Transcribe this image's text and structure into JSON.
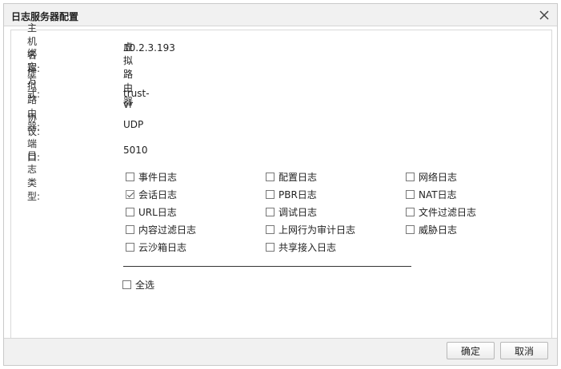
{
  "dialog": {
    "title": "日志服务器配置"
  },
  "fields": [
    {
      "label": "主机名称:",
      "value": "10.2.3.193"
    },
    {
      "label": "绑定方式:",
      "value": "虚拟路由器"
    },
    {
      "label": "虚拟路由器:",
      "value": "trust-vr"
    },
    {
      "label": "协议:",
      "value": "UDP"
    },
    {
      "label": "端口:",
      "value": "5010"
    }
  ],
  "log_types": {
    "label": "日志类型:",
    "items": [
      {
        "label": "事件日志",
        "checked": false
      },
      {
        "label": "配置日志",
        "checked": false
      },
      {
        "label": "网络日志",
        "checked": false
      },
      {
        "label": "会话日志",
        "checked": true
      },
      {
        "label": "PBR日志",
        "checked": false
      },
      {
        "label": "NAT日志",
        "checked": false
      },
      {
        "label": "URL日志",
        "checked": false
      },
      {
        "label": "调试日志",
        "checked": false
      },
      {
        "label": "文件过滤日志",
        "checked": false
      },
      {
        "label": "内容过滤日志",
        "checked": false
      },
      {
        "label": "上网行为审计日志",
        "checked": false
      },
      {
        "label": "威胁日志",
        "checked": false
      },
      {
        "label": "云沙箱日志",
        "checked": false
      },
      {
        "label": "共享接入日志",
        "checked": false
      }
    ],
    "select_all": {
      "label": "全选",
      "checked": false
    }
  },
  "footer": {
    "ok_label": "确定",
    "cancel_label": "取消"
  }
}
